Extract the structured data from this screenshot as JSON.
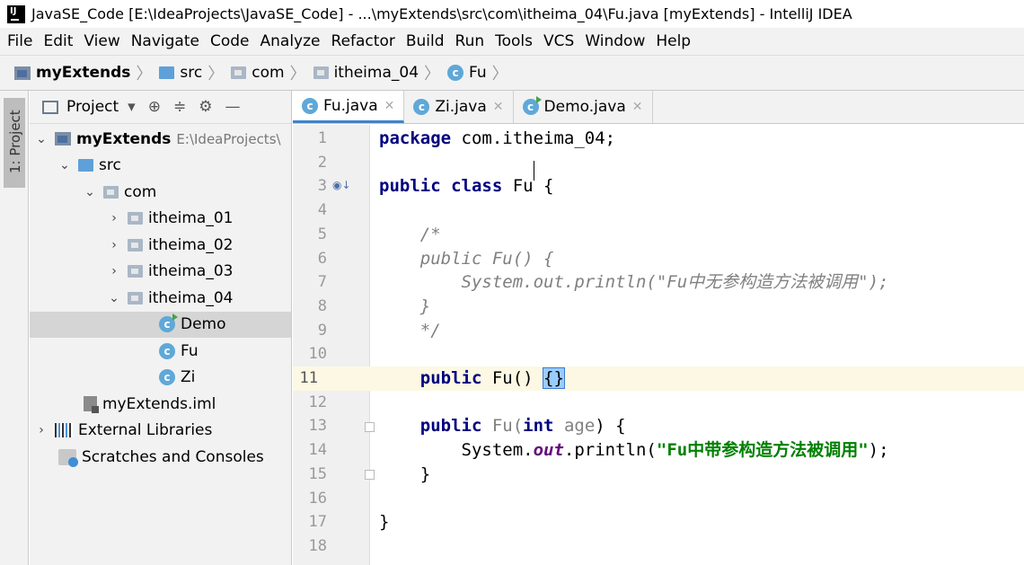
{
  "window": {
    "title": "JavaSE_Code [E:\\IdeaProjects\\JavaSE_Code] - ...\\myExtends\\src\\com\\itheima_04\\Fu.java [myExtends] - IntelliJ IDEA",
    "app_icon_label": "IJ"
  },
  "menu": {
    "items": [
      "File",
      "Edit",
      "View",
      "Navigate",
      "Code",
      "Analyze",
      "Refactor",
      "Build",
      "Run",
      "Tools",
      "VCS",
      "Window",
      "Help"
    ]
  },
  "breadcrumb": {
    "items": [
      "myExtends",
      "src",
      "com",
      "itheima_04",
      "Fu"
    ]
  },
  "tool_stripe": {
    "project_tab": "1: Project"
  },
  "project_panel": {
    "title": "Project",
    "tree": {
      "root_name": "myExtends",
      "root_path": "E:\\IdeaProjects\\",
      "src": "src",
      "com": "com",
      "pkg1": "itheima_01",
      "pkg2": "itheima_02",
      "pkg3": "itheima_03",
      "pkg4": "itheima_04",
      "demo": "Demo",
      "fu": "Fu",
      "zi": "Zi",
      "iml": "myExtends.iml",
      "external_libraries": "External Libraries",
      "scratches": "Scratches and Consoles"
    }
  },
  "editor": {
    "tabs": [
      {
        "label": "Fu.java",
        "active": true
      },
      {
        "label": "Zi.java",
        "active": false
      },
      {
        "label": "Demo.java",
        "active": false
      }
    ],
    "current_line": 11,
    "line_numbers": [
      "1",
      "2",
      "3",
      "4",
      "5",
      "6",
      "7",
      "8",
      "9",
      "10",
      "11",
      "12",
      "13",
      "14",
      "15",
      "16",
      "17",
      "18"
    ],
    "code": {
      "l1_kw": "package",
      "l1_rest": " com.itheima_04;",
      "l3_kw": "public class",
      "l3_rest": " Fu {",
      "l5": "    /*",
      "l6": "    public Fu() {",
      "l7": "        System.out.println(\"Fu中无参构造方法被调用\");",
      "l8": "    }",
      "l9": "    */",
      "l11_kw": "public",
      "l11_name": " Fu() ",
      "l11_braces": "{}",
      "l13_kw": "public",
      "l13_name": " Fu(",
      "l13_type": "int",
      "l13_param": " age",
      "l13_end": ") {",
      "l14_a": "        System.",
      "l14_field": "out",
      "l14_b": ".println(",
      "l14_str": "\"Fu中带参构造方法被调用\"",
      "l14_c": ");",
      "l15": "    }",
      "l17": "}"
    }
  },
  "colors": {
    "keyword": "#000080",
    "string": "#008000",
    "comment": "#808080",
    "field": "#660e7a",
    "current_line_bg": "#fdf8e3",
    "tab_active_underline": "#4083c9"
  }
}
